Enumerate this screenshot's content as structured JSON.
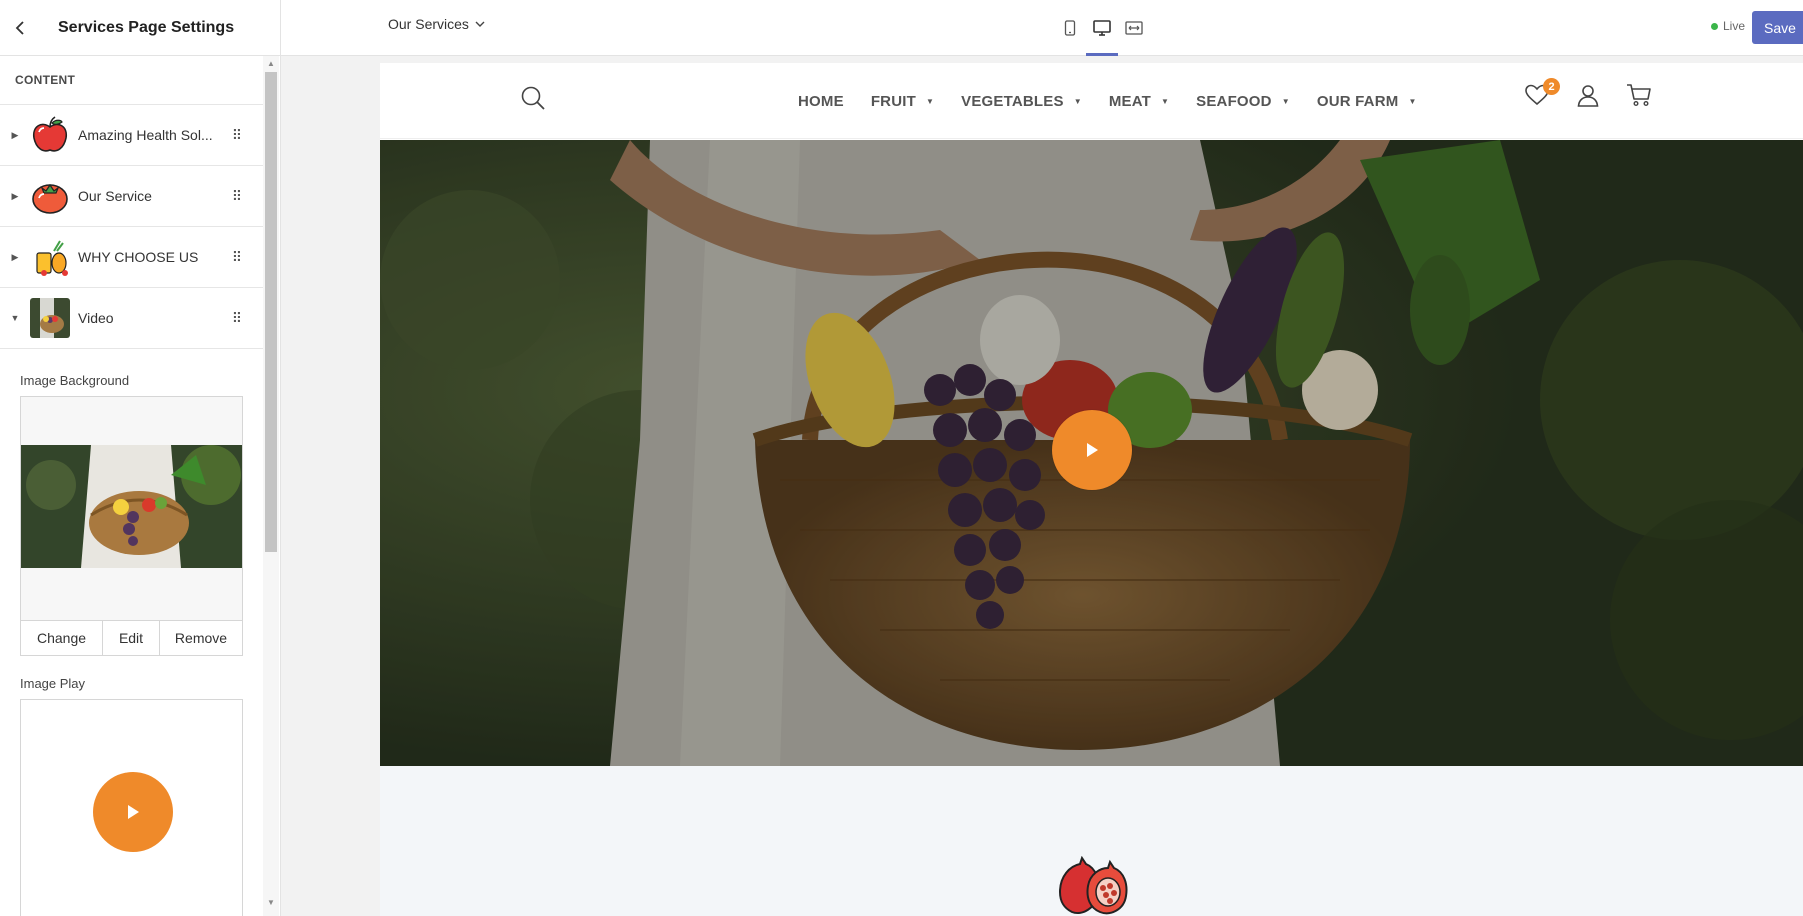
{
  "topbar": {
    "panel_title": "Services Page Settings",
    "page_select": "Our Services",
    "live_label": "Live",
    "save_label": "Save",
    "devices": [
      "mobile-icon",
      "desktop-icon",
      "fullwidth-icon"
    ]
  },
  "sidebar": {
    "section_label": "CONTENT",
    "blocks": [
      {
        "label": "Amazing Health Sol...",
        "icon": "apple-icon",
        "expanded": false
      },
      {
        "label": "Our Service",
        "icon": "tomato-icon",
        "expanded": false
      },
      {
        "label": "WHY CHOOSE US",
        "icon": "fruits-icon",
        "expanded": false
      },
      {
        "label": "Video",
        "icon": "video-thumb",
        "expanded": true
      }
    ],
    "image_background_label": "Image Background",
    "buttons": {
      "change": "Change",
      "edit": "Edit",
      "remove": "Remove"
    },
    "image_play_label": "Image Play"
  },
  "site": {
    "nav": [
      {
        "label": "HOME",
        "dropdown": false
      },
      {
        "label": "FRUIT",
        "dropdown": true
      },
      {
        "label": "VEGETABLES",
        "dropdown": true
      },
      {
        "label": "MEAT",
        "dropdown": true
      },
      {
        "label": "SEAFOOD",
        "dropdown": true
      },
      {
        "label": "OUR FARM",
        "dropdown": true
      }
    ],
    "wishlist_count": "2"
  },
  "colors": {
    "accent": "#ef8a2a",
    "primary": "#5b6bc0",
    "live": "#3bb54a"
  }
}
